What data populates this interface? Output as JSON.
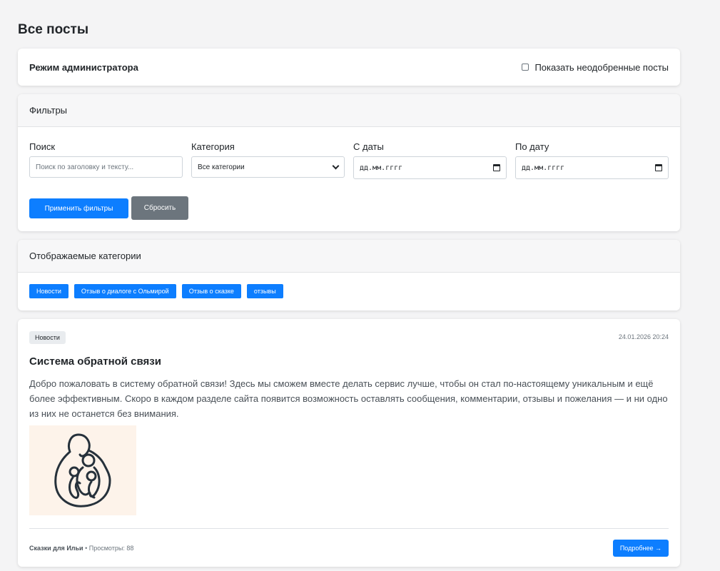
{
  "page": {
    "title": "Все посты"
  },
  "admin": {
    "title": "Режим администратора",
    "toggle_label": "Показать неодобренные посты"
  },
  "filters": {
    "header": "Фильтры",
    "search": {
      "label": "Поиск",
      "placeholder": "Поиск по заголовку и тексту..."
    },
    "category": {
      "label": "Категория",
      "selected": "Все категории"
    },
    "date_from": {
      "label": "С даты",
      "placeholder": "дд.мм.гггг"
    },
    "date_to": {
      "label": "По дату",
      "placeholder": "дд.мм.гггг"
    },
    "apply_label": "Применить фильтры",
    "reset_label": "Сбросить"
  },
  "categories": {
    "header": "Отображаемые категории",
    "items": [
      "Новости",
      "Отзыв о диалоге с Ольмирой",
      "Отзыв о сказке",
      "отзывы"
    ]
  },
  "post": {
    "category": "Новости",
    "date": "24.01.2026 20:24",
    "title": "Система обратной связи",
    "text": "Добро пожаловать в систему обратной связи! Здесь мы сможем вместе делать сервис лучше, чтобы он стал по-настоящему уникальным и ещё более эффективным. Скоро в каждом разделе сайта появится возможность оставлять сообщения, комментарии, отзывы и пожелания — и ни одно из них не останется без внимания.",
    "author": "Сказки для Ильи",
    "views": "• Просмотры: 88",
    "more_label": "Подробнее →"
  },
  "colors": {
    "primary": "#0d7eff",
    "secondary": "#6c757d",
    "background": "#f4f4f5",
    "image_bg": "#fdf3ea"
  }
}
